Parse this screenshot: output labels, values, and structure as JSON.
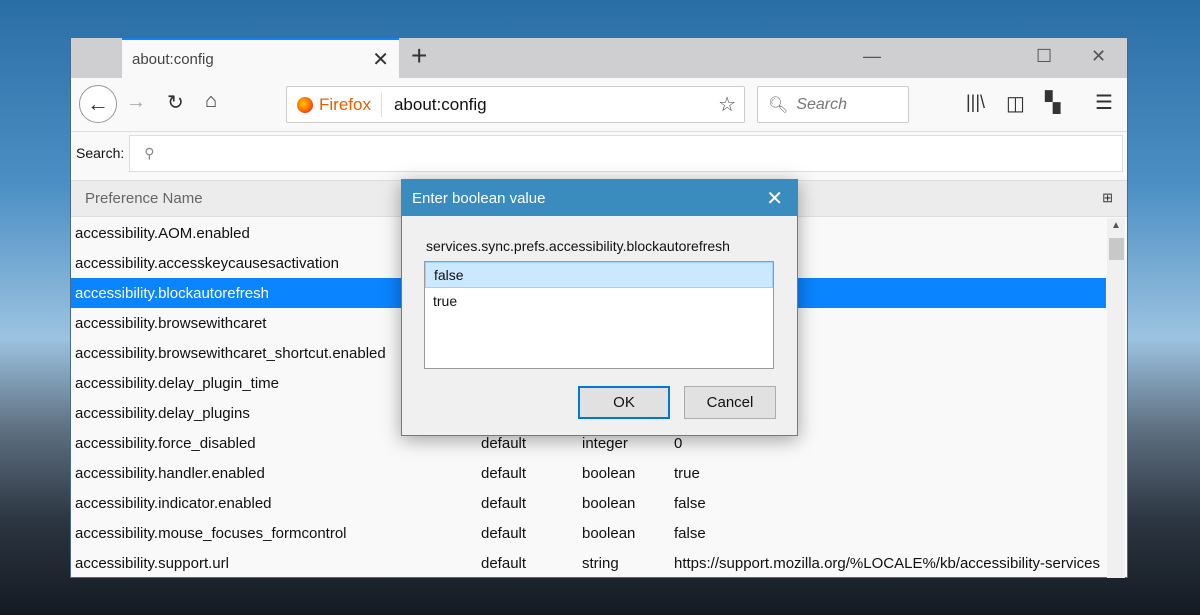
{
  "tab": {
    "title": "about:config"
  },
  "nav": {
    "identity": "Firefox",
    "url": "about:config",
    "search_placeholder": "Search"
  },
  "config": {
    "search_label": "Search:",
    "column_header": "Preference Name"
  },
  "rows": [
    {
      "name": "accessibility.AOM.enabled",
      "status": "",
      "type": "",
      "value": ""
    },
    {
      "name": "accessibility.accesskeycausesactivation",
      "status": "",
      "type": "",
      "value": ""
    },
    {
      "name": "accessibility.blockautorefresh",
      "status": "",
      "type": "",
      "value": "",
      "selected": true
    },
    {
      "name": "accessibility.browsewithcaret",
      "status": "",
      "type": "",
      "value": ""
    },
    {
      "name": "accessibility.browsewithcaret_shortcut.enabled",
      "status": "",
      "type": "",
      "value": ""
    },
    {
      "name": "accessibility.delay_plugin_time",
      "status": "",
      "type": "",
      "value": ""
    },
    {
      "name": "accessibility.delay_plugins",
      "status": "",
      "type": "",
      "value": ""
    },
    {
      "name": "accessibility.force_disabled",
      "status": "default",
      "type": "integer",
      "value": "0"
    },
    {
      "name": "accessibility.handler.enabled",
      "status": "default",
      "type": "boolean",
      "value": "true"
    },
    {
      "name": "accessibility.indicator.enabled",
      "status": "default",
      "type": "boolean",
      "value": "false"
    },
    {
      "name": "accessibility.mouse_focuses_formcontrol",
      "status": "default",
      "type": "boolean",
      "value": "false"
    },
    {
      "name": "accessibility.support.url",
      "status": "default",
      "type": "string",
      "value": "https://support.mozilla.org/%LOCALE%/kb/accessibility-services"
    }
  ],
  "dialog": {
    "title": "Enter boolean value",
    "pref": "services.sync.prefs.accessibility.blockautorefresh",
    "options": [
      "false",
      "true"
    ],
    "ok": "OK",
    "cancel": "Cancel"
  }
}
